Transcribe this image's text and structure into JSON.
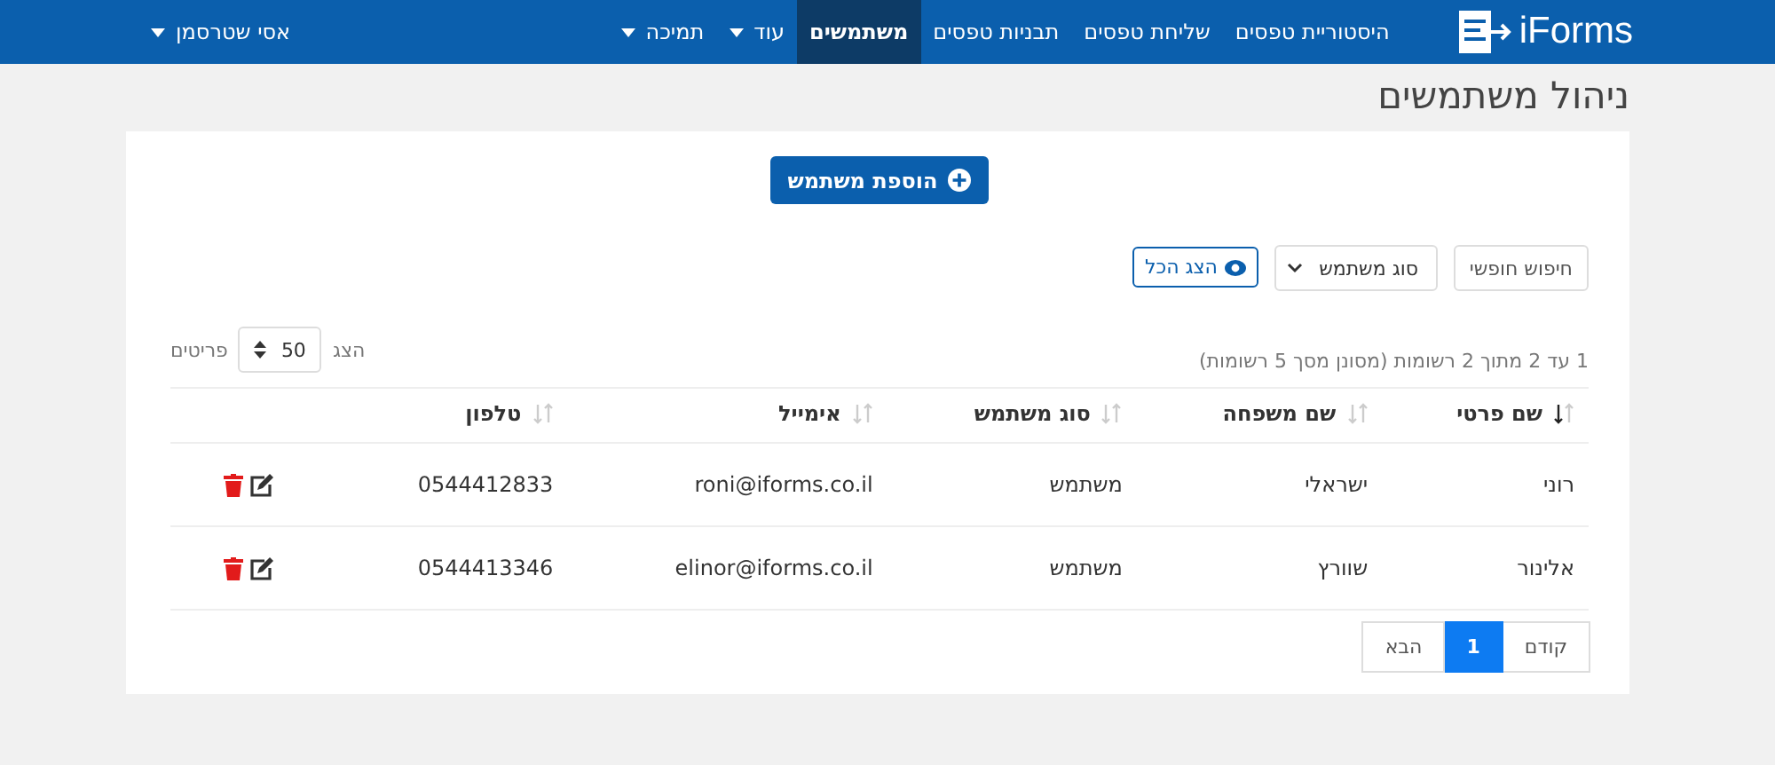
{
  "navbar": {
    "brand": "iForms",
    "items": [
      {
        "label": "היסטוריית טפסים",
        "selected": false,
        "dropdown": false
      },
      {
        "label": "שליחת טפסים",
        "selected": false,
        "dropdown": false
      },
      {
        "label": "תבניות טפסים",
        "selected": false,
        "dropdown": false
      },
      {
        "label": "משתמשים",
        "selected": true,
        "dropdown": false
      },
      {
        "label": "עוד",
        "selected": false,
        "dropdown": true
      },
      {
        "label": "תמיכה",
        "selected": false,
        "dropdown": true
      }
    ],
    "user_menu": {
      "label": "אסי שטרסמן",
      "dropdown": true
    }
  },
  "page_title": "ניהול משתמשים",
  "add_button": "הוספת משתמש",
  "filters": {
    "search": {
      "placeholder": "חיפוש חופשי"
    },
    "user_type": {
      "value": "סוג משתמש"
    },
    "show_all": "הצג הכל"
  },
  "summary": "1 עד 2 מתוך 2 רשומות (מסונן מסך 5 רשומות)",
  "page_size": {
    "prefix": "הצג",
    "value": "50",
    "suffix": "פריטים"
  },
  "table": {
    "columns": [
      {
        "label": "שם פרטי",
        "sorted": true
      },
      {
        "label": "שם משפחה",
        "sorted": false
      },
      {
        "label": "סוג משתמש",
        "sorted": false
      },
      {
        "label": "אימייל",
        "sorted": false
      },
      {
        "label": "טלפון",
        "sorted": false
      }
    ],
    "rows": [
      {
        "cells": [
          "רוני",
          "ישראלי",
          "משתמש",
          "roni@iforms.co.il",
          "0544412833"
        ]
      },
      {
        "cells": [
          "אלינור",
          "שוורץ",
          "משתמש",
          "elinor@iforms.co.il",
          "0544413346"
        ]
      }
    ]
  },
  "pagination": {
    "previous": "קודם",
    "pages": [
      {
        "label": "1",
        "selected": true
      }
    ],
    "next": "הבא"
  }
}
